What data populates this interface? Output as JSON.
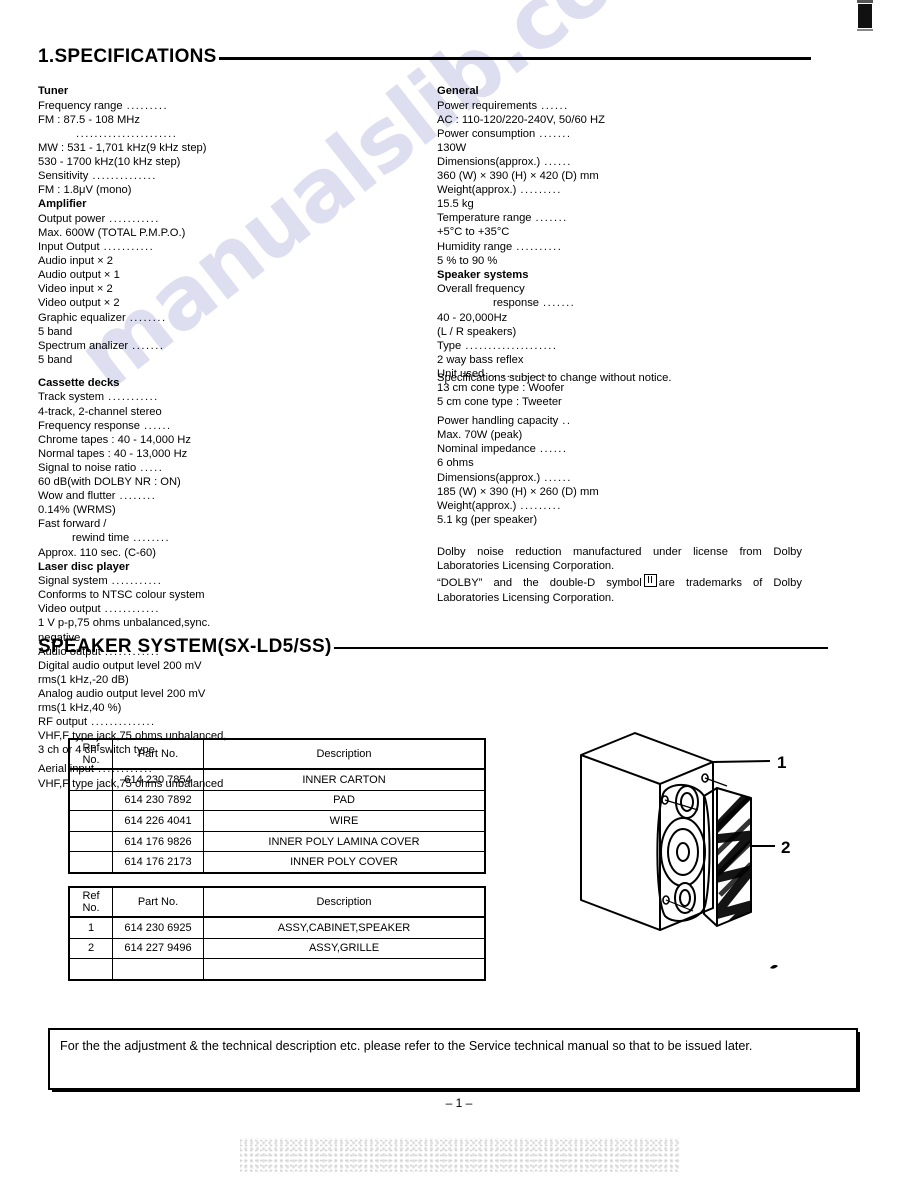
{
  "document": {
    "page_number": "– 1 –",
    "watermark": "manualslib.com"
  },
  "sections": {
    "specifications": {
      "heading": "1.SPECIFICATIONS"
    },
    "speaker_system": {
      "heading": "SPEAKER  SYSTEM(SX-LD5/SS)"
    }
  },
  "specs_left": {
    "tuner": {
      "group": "Tuner",
      "rows": [
        {
          "label": "Frequency range",
          "leader": ".........",
          "value": "FM :  87.5 - 108 MHz"
        },
        {
          "label": "",
          "leader": "......................",
          "value": "MW :  531 - 1,701 kHz(9 kHz step)"
        },
        {
          "label": "",
          "leader": "",
          "value": "530 - 1700  kHz(10  kHz step)"
        },
        {
          "label": "Sensitivity",
          "leader": "..............",
          "value": "FM :  1.8μV (mono)"
        }
      ]
    },
    "amplifier": {
      "group": "Amplifier",
      "rows": [
        {
          "label": "Output power",
          "leader": "...........",
          "value": "Max. 600W (TOTAL P.M.P.O.)"
        },
        {
          "label": "Input Output",
          "leader": "...........",
          "value": "Audio input × 2"
        },
        {
          "label": "",
          "leader": "",
          "value": "Audio output × 1"
        },
        {
          "label": "",
          "leader": "",
          "value": "Video input × 2"
        },
        {
          "label": "",
          "leader": "",
          "value": "Video output × 2"
        },
        {
          "label": "Graphic equalizer",
          "leader": "........",
          "value": "5 band"
        },
        {
          "label": "Spectrum analizer",
          "leader": ".......",
          "value": "5 band"
        }
      ]
    },
    "cassette": {
      "group": "Cassette decks",
      "rows": [
        {
          "label": "Track system",
          "leader": "...........",
          "value": "4-track, 2-channel stereo"
        },
        {
          "label": "Frequency response",
          "leader": "......",
          "value": "Chrome tapes : 40 - 14,000 Hz"
        },
        {
          "label": "",
          "leader": "",
          "value": "Normal tapes : 40 - 13,000 Hz"
        },
        {
          "label": "Signal to noise ratio",
          "leader": ".....",
          "value": "60 dB(with DOLBY NR : ON)"
        },
        {
          "label": "Wow and flutter",
          "leader": "........",
          "value": "0.14% (WRMS)"
        },
        {
          "label": "Fast forward /",
          "leader": "",
          "value": ""
        },
        {
          "label": "rewind time",
          "leader": "........",
          "value": "Approx. 110 sec. (C-60)"
        }
      ]
    },
    "laserdisc": {
      "group": "Laser disc player",
      "rows": [
        {
          "label": "Signal system",
          "leader": "...........",
          "value": "Conforms to NTSC colour system"
        },
        {
          "label": "Video output",
          "leader": "............",
          "value": "1 V p-p,75 ohms unbalanced,sync."
        },
        {
          "label": "",
          "leader": "",
          "value": "negative"
        },
        {
          "label": "Audio output",
          "leader": "............",
          "value": "Digital audio output level 200 mV"
        },
        {
          "label": "",
          "leader": "",
          "value": "rms(1 kHz,-20 dB)"
        },
        {
          "label": "",
          "leader": "",
          "value": "Analog audio output level 200 mV"
        },
        {
          "label": "",
          "leader": "",
          "value": "rms(1 kHz,40 %)"
        },
        {
          "label": "RF output",
          "leader": "..............",
          "value": "VHF,F type jack,75 ohms unbalanced,"
        },
        {
          "label": "",
          "leader": "",
          "value": "3 ch or 4 ch switch type"
        },
        {
          "label": "Aerial input",
          "leader": "............",
          "value": "VHF,F type jack,75 ohms unbalanced"
        }
      ]
    }
  },
  "specs_right": {
    "general": {
      "group": "General",
      "rows": [
        {
          "label": "Power requirements",
          "leader": "......",
          "value": "AC : 110-120/220-240V, 50/60 HZ"
        },
        {
          "label": "Power consumption",
          "leader": ".......",
          "value": "130W"
        },
        {
          "label": "Dimensions(approx.)",
          "leader": "......",
          "value": "360 (W)  ×  390 (H)  ×  420 (D) mm"
        },
        {
          "label": "Weight(approx.)",
          "leader": ".........",
          "value": "15.5 kg"
        },
        {
          "label": "Temperature range",
          "leader": ".......",
          "value": "+5°C to  +35°C"
        },
        {
          "label": "Humidity range",
          "leader": "..........",
          "value": "5 % to 90 %"
        }
      ]
    },
    "speaker_systems": {
      "group": "Speaker systems",
      "rows": [
        {
          "label": "Overall frequency",
          "leader": "",
          "value": ""
        },
        {
          "label": "response",
          "leader": ".......",
          "value": "40 - 20,000Hz"
        },
        {
          "label": "(L / R speakers)",
          "leader": "",
          "value": ""
        },
        {
          "label": "Type",
          "leader": "....................",
          "value": "2 way bass reflex"
        },
        {
          "label": "Unit used",
          "leader": "..............",
          "value": "13 cm cone type : Woofer"
        },
        {
          "label": "",
          "leader": "",
          "value": "5 cm cone type : Tweeter"
        },
        {
          "label": "Power handling capacity",
          "leader": "..",
          "value": "Max. 70W (peak)"
        },
        {
          "label": "Nominal impedance",
          "leader": "......",
          "value": "6 ohms"
        },
        {
          "label": "Dimensions(approx.)",
          "leader": "......",
          "value": "185 (W)  ×  390 (H)  ×  260 (D) mm"
        },
        {
          "label": "Weight(approx.)",
          "leader": ".........",
          "value": "5.1 kg (per speaker)"
        }
      ]
    },
    "spec_notice": "Specifications subject to change without notice.",
    "dolby_notice": {
      "line1": "Dolby  noise  reduction  manufactured  under  license  from  Dolby Laboratories Licensing Corporation.",
      "line2_pre": "“DOLBY”  and  the  double-D  symbol",
      "line2_post": "are  trademarks  of Dolby Laboratories Licensing Corporation."
    }
  },
  "table1": {
    "headers": {
      "ref": "Ref\nNo.",
      "ref_l1": "Ref",
      "ref_l2": "No.",
      "part": "Part No.",
      "desc": "Description"
    },
    "rows": [
      {
        "ref": "",
        "part": "614 230 7854",
        "desc": "INNER CARTON"
      },
      {
        "ref": "",
        "part": "614 230 7892",
        "desc": "PAD"
      },
      {
        "ref": "",
        "part": "614 226 4041",
        "desc": "WIRE"
      },
      {
        "ref": "",
        "part": "614 176 9826",
        "desc": "INNER POLY LAMINA COVER"
      },
      {
        "ref": "",
        "part": "614 176 2173",
        "desc": "INNER POLY COVER"
      }
    ]
  },
  "table2": {
    "headers": {
      "ref_l1": "Ref",
      "ref_l2": "No.",
      "part": "Part No.",
      "desc": "Description"
    },
    "rows": [
      {
        "ref": "1",
        "part": "614 230 6925",
        "desc": "ASSY,CABINET,SPEAKER"
      },
      {
        "ref": "2",
        "part": "614 227 9496",
        "desc": "ASSY,GRILLE"
      },
      {
        "ref": "",
        "part": "",
        "desc": ""
      }
    ]
  },
  "illustration": {
    "callout_1": "1",
    "callout_2": "2"
  },
  "bottom_notice": {
    "text": "For the the adjustment & the technical description etc. please  refer to the Service technical  manual  so that to be issued later."
  }
}
